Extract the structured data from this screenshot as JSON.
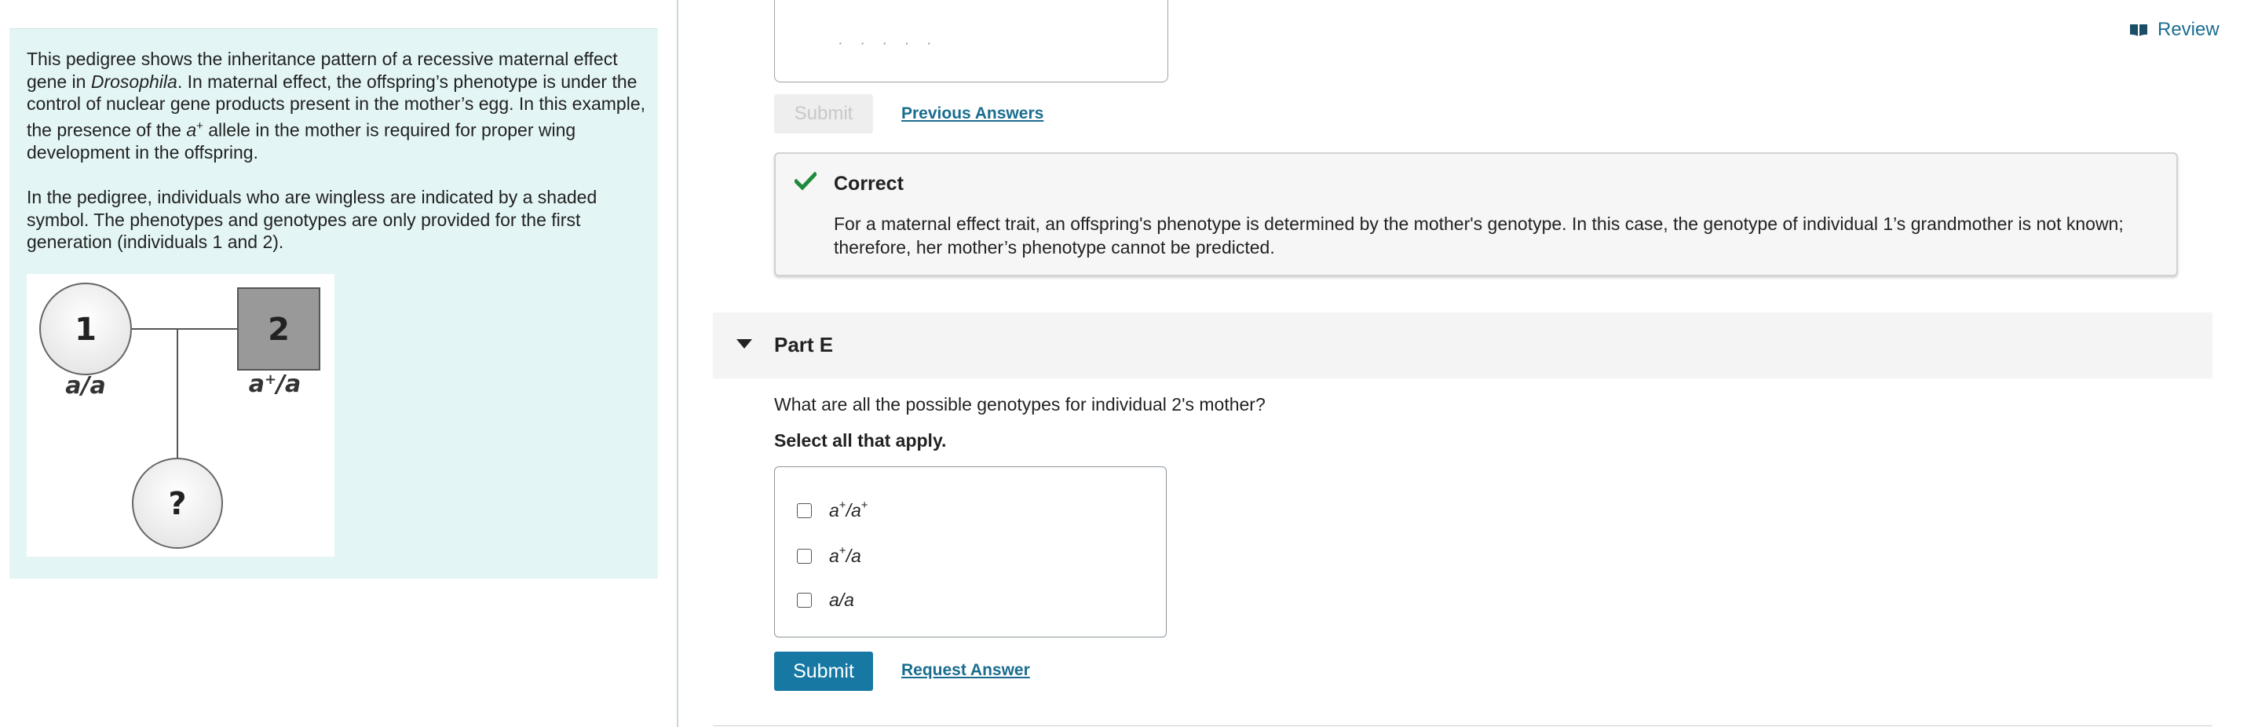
{
  "intro": {
    "p1_part1": "This pedigree shows the inheritance pattern of a recessive maternal effect gene in ",
    "p1_italic": "Drosophila",
    "p1_part2": ". In maternal effect, the offspring’s phenotype is under the control of nuclear gene products present in the mother’s egg. In this example, the presence of the ",
    "p1_allele": "a",
    "p1_sup": "+",
    "p1_part3": " allele in the mother is required for proper wing development in the offspring.",
    "p2": "In the pedigree, individuals who are wingless are indicated by a shaded symbol. The phenotypes and genotypes are only provided for the first generation (individuals 1 and 2)."
  },
  "pedigree": {
    "individual1": {
      "number": "1",
      "genotype": "a/a",
      "shaded": false,
      "shape": "circle"
    },
    "individual2": {
      "number": "2",
      "genotype_base": "a",
      "genotype_sup": "+",
      "genotype_rest": "/a",
      "shaded": true,
      "shape": "square"
    },
    "offspring": {
      "label": "?",
      "shape": "circle"
    },
    "colors": {
      "shaded_fill": "#999999",
      "outline": "#555555"
    }
  },
  "review": {
    "label": "Review",
    "icon": "book-icon"
  },
  "previous_part": {
    "submit_label": "Submit",
    "previous_answers_label": "Previous Answers"
  },
  "feedback": {
    "status": "Correct",
    "icon": "checkmark-icon",
    "color": "#1e8a3c",
    "text": "For a maternal effect trait, an offspring's phenotype is determined by the mother's genotype. In this case, the genotype of individual 1’s grandmother is not known; therefore, her mother’s phenotype cannot be predicted."
  },
  "part_e": {
    "title": "Part E",
    "question": "What are all the possible genotypes for individual 2's mother?",
    "instruction": "Select all that apply.",
    "options": [
      {
        "base": "a",
        "sup": "+",
        "rest": "/a",
        "sup2": "+",
        "checked": false
      },
      {
        "base": "a",
        "sup": "+",
        "rest": "/a",
        "checked": false
      },
      {
        "base": "a/a",
        "checked": false
      }
    ],
    "submit_label": "Submit",
    "request_answer_label": "Request Answer"
  },
  "theme": {
    "accent": "#1779a3",
    "link": "#1a6d8f",
    "intro_bg": "#e4f5f5"
  }
}
